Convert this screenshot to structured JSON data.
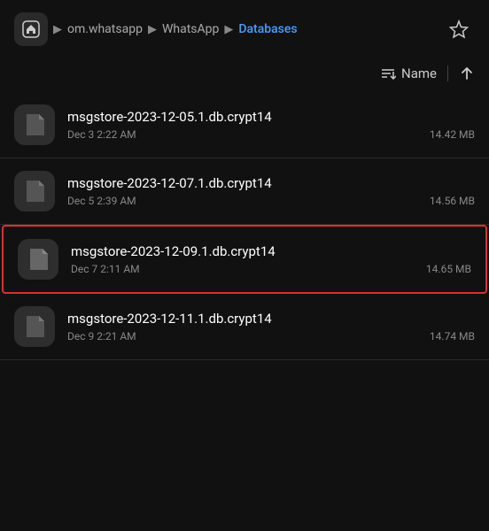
{
  "header": {
    "home_icon_label": "home",
    "breadcrumb": [
      {
        "label": "om.whatsapp",
        "active": false
      },
      {
        "label": "WhatsApp",
        "active": false
      },
      {
        "label": "Databases",
        "active": true
      }
    ],
    "star_icon": "star"
  },
  "sort": {
    "sort_icon": "sort",
    "sort_label": "Name",
    "arrow_icon": "arrow-up"
  },
  "files": [
    {
      "name": "msgstore-2023-12-05.1.db.crypt14",
      "date": "Dec 3 2:22 AM",
      "size": "14.42 MB",
      "selected": false,
      "icon": "file"
    },
    {
      "name": "msgstore-2023-12-07.1.db.crypt14",
      "date": "Dec 5 2:39 AM",
      "size": "14.56 MB",
      "selected": false,
      "icon": "file"
    },
    {
      "name": "msgstore-2023-12-09.1.db.crypt14",
      "date": "Dec 7 2:11 AM",
      "size": "14.65 MB",
      "selected": true,
      "icon": "file"
    },
    {
      "name": "msgstore-2023-12-11.1.db.crypt14",
      "date": "Dec 9 2:21 AM",
      "size": "14.74 MB",
      "selected": false,
      "icon": "file"
    }
  ]
}
